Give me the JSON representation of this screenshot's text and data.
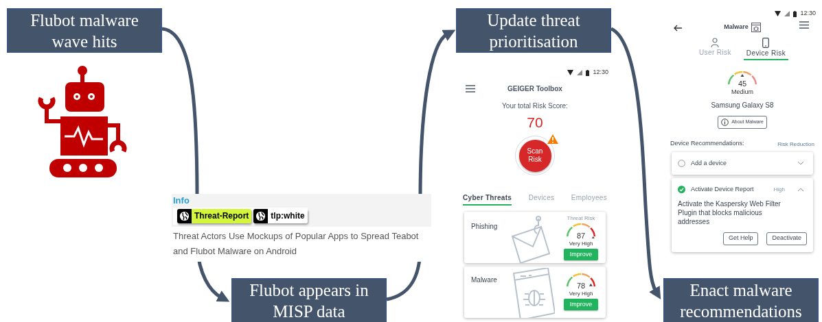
{
  "steps": [
    {
      "text": "Flubot malware wave hits"
    },
    {
      "text": "Flubot appears in MISP data"
    },
    {
      "text": "Update threat prioritisation"
    },
    {
      "text": "Enact malware recommendations"
    }
  ],
  "misp": {
    "section": "Info",
    "tags": [
      {
        "label": "Threat-Report",
        "color": "#d4f53c"
      },
      {
        "label": "tlp:white",
        "color": "#ffffff"
      }
    ],
    "headline": "Threat Actors Use Mockups of Popular Apps to Spread Teabot and Flubot Malware on Android"
  },
  "toolbox": {
    "status_time": "12:30",
    "title": "GEIGER Toolbox",
    "score_label": "Your total Risk Score:",
    "score": "70",
    "scan_button": "Scan Risk",
    "warning": true,
    "tabs": [
      {
        "label": "Cyber Threats",
        "selected": true
      },
      {
        "label": "Devices",
        "selected": false
      },
      {
        "label": "Employees",
        "selected": false
      }
    ],
    "threats": [
      {
        "kind": "phishing",
        "name": "Phishing",
        "risk_label": "Threat Risk",
        "score": "87",
        "rating": "Very High",
        "level": 0.87,
        "button": "Improve"
      },
      {
        "kind": "malware",
        "name": "Malware",
        "score": "78",
        "rating": "Very High",
        "level": 0.8,
        "button": "Improve"
      }
    ]
  },
  "malware_page": {
    "status_time": "12:30",
    "title": "Malware",
    "tabs": [
      {
        "kind": "user",
        "label": "User Risk",
        "selected": false
      },
      {
        "kind": "device",
        "label": "Device Risk",
        "selected": true
      }
    ],
    "gauge": {
      "score": "45",
      "rating": "Medium",
      "level": 0.5
    },
    "device": "Samsung Galaxy S8",
    "about_button": "About Malware",
    "recommendations_label": "Device Recommendations:",
    "reduction_label": "Risk Reduction",
    "recommendations": [
      {
        "title": "Add a device",
        "checked": false,
        "expanded": false
      },
      {
        "title": "Activate Device Report",
        "reduction": "High",
        "checked": true,
        "expanded": true,
        "description": "Activate the Kaspersky Web Filter Plugin that blocks malicious addresses",
        "buttons": [
          "Get Help",
          "Deactivate"
        ]
      }
    ]
  }
}
